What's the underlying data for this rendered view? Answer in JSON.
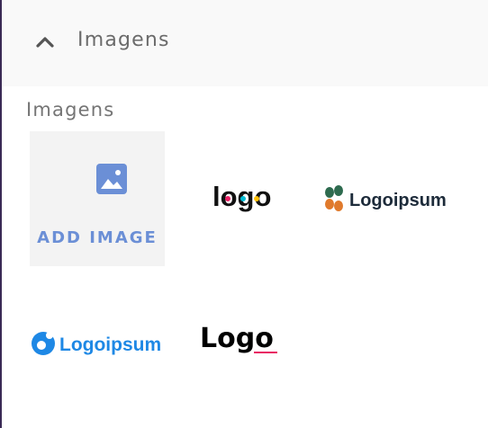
{
  "section": {
    "title": "Imagens",
    "expanded": true
  },
  "gallery": {
    "label": "Imagens",
    "add_image_label": "ADD IMAGE",
    "images": [
      {
        "alt": "logo"
      },
      {
        "alt": "Logoipsum"
      },
      {
        "alt": "Logoipsum"
      },
      {
        "alt": "logo"
      }
    ]
  },
  "logos": {
    "logo1_text": "logo",
    "logo2_text": "Logoipsum",
    "logo3_text": "Logoipsum",
    "logo4_text": "Logo"
  },
  "colors": {
    "accent_blue": "#6b8fd6",
    "header_bg": "#f9f9f9",
    "tile_bg": "#f3f3f3",
    "logo_blue": "#1e88e5",
    "logo_dark": "#1d2b3a"
  }
}
